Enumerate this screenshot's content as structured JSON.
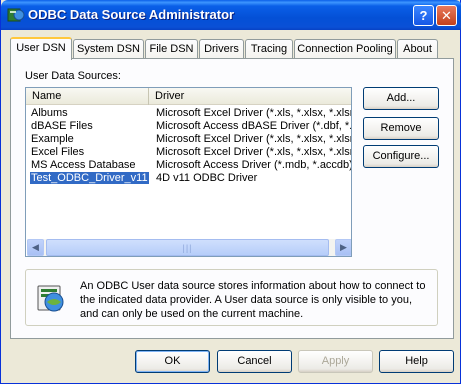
{
  "window": {
    "title": "ODBC Data Source Administrator",
    "help_button": "?",
    "close_button": "✕"
  },
  "tabs": [
    {
      "label": "User DSN",
      "active": true
    },
    {
      "label": "System DSN",
      "active": false
    },
    {
      "label": "File DSN",
      "active": false
    },
    {
      "label": "Drivers",
      "active": false
    },
    {
      "label": "Tracing",
      "active": false
    },
    {
      "label": "Connection Pooling",
      "active": false
    },
    {
      "label": "About",
      "active": false
    }
  ],
  "sources_label": "User Data Sources:",
  "list": {
    "columns": [
      "Name",
      "Driver"
    ],
    "rows": [
      {
        "name": "Albums",
        "driver": "Microsoft Excel Driver (*.xls, *.xlsx, *.xlsm,"
      },
      {
        "name": "dBASE Files",
        "driver": "Microsoft Access dBASE Driver (*.dbf, *.n"
      },
      {
        "name": "Example",
        "driver": "Microsoft Excel Driver (*.xls, *.xlsx, *.xlsm,"
      },
      {
        "name": "Excel Files",
        "driver": "Microsoft Excel Driver (*.xls, *.xlsx, *.xlsm,"
      },
      {
        "name": "MS Access Database",
        "driver": "Microsoft Access Driver (*.mdb, *.accdb)"
      },
      {
        "name": "Test_ODBC_Driver_v11",
        "driver": "4D v11 ODBC Driver",
        "selected": true
      }
    ],
    "scroll_left": "◀",
    "scroll_right": "▶",
    "scroll_grip": "|||"
  },
  "side_buttons": {
    "add": "Add...",
    "remove": "Remove",
    "configure": "Configure..."
  },
  "info": {
    "icon": "odbc-datasource-icon",
    "text": "An ODBC User data source stores information about how to connect to the indicated data provider.   A User data source is only visible to you, and can only be used on the current machine."
  },
  "footer": {
    "ok": "OK",
    "cancel": "Cancel",
    "apply": "Apply",
    "help": "Help"
  }
}
